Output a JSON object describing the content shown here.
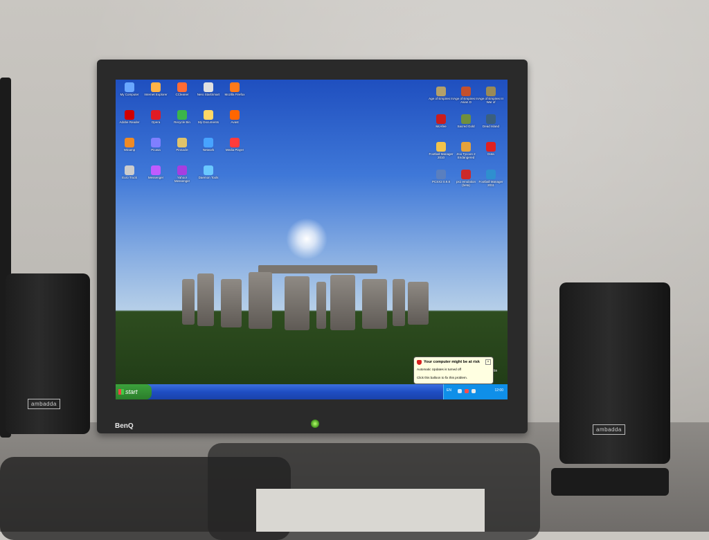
{
  "monitor": {
    "brand": "BenQ"
  },
  "speakers": {
    "brand": "ambadda"
  },
  "desktop": {
    "icons_left": [
      {
        "label": "My Computer",
        "color": "#6aa7ff"
      },
      {
        "label": "Internet Explorer",
        "color": "#ffb347"
      },
      {
        "label": "CCleaner",
        "color": "#ff6b35"
      },
      {
        "label": "Nero StartSmart",
        "color": "#e0e0e0"
      },
      {
        "label": "Mozilla Firefox",
        "color": "#ff7a1a"
      },
      {
        "label": "Adobe Reader",
        "color": "#d00000"
      },
      {
        "label": "Opera",
        "color": "#e01b24"
      },
      {
        "label": "Recycle Bin",
        "color": "#3bb54a"
      },
      {
        "label": "My Documents",
        "color": "#ffd866"
      },
      {
        "label": "Avast",
        "color": "#ff6600"
      },
      {
        "label": "Winamp",
        "color": "#f08a24"
      },
      {
        "label": "Picasa",
        "color": "#7f7fff"
      },
      {
        "label": "Pinnacle",
        "color": "#e0c36a"
      },
      {
        "label": "Network",
        "color": "#47a3ff"
      },
      {
        "label": "Media Player",
        "color": "#ff3b3b"
      },
      {
        "label": "Euro Truck",
        "color": "#cccccc"
      },
      {
        "label": "Messenger",
        "color": "#c05cff"
      },
      {
        "label": "Yahoo! Messenger",
        "color": "#a63ee0"
      },
      {
        "label": "Daemon Tools",
        "color": "#6ac8ff"
      }
    ],
    "icons_right": [
      {
        "label": "Age of Empires III",
        "color": "#b3a06a"
      },
      {
        "label": "Age of Empires III Asian D",
        "color": "#c4502e"
      },
      {
        "label": "Age of Empires III War of",
        "color": "#9a8a56"
      },
      {
        "label": "McAfee",
        "color": "#c91d1d"
      },
      {
        "label": "Sacred Gold",
        "color": "#6f8f3f"
      },
      {
        "label": "Dead Island",
        "color": "#3a5f7f"
      },
      {
        "label": "Football Manager 2010",
        "color": "#f2c34b"
      },
      {
        "label": "Zoo Tycoon 2 Endangered",
        "color": "#e6a23b"
      },
      {
        "label": "Dota",
        "color": "#e02020"
      },
      {
        "label": "PCSX2 0.9.8",
        "color": "#5a7fbf"
      },
      {
        "label": "ps1 emulation (beta)",
        "color": "#cc2a2a"
      },
      {
        "label": "Football Manager 2011",
        "color": "#2f8fcf"
      }
    ],
    "recycle_bin": "Bin"
  },
  "taskbar": {
    "start_label": "start",
    "language": "EN",
    "clock": "12:00"
  },
  "balloon": {
    "title": "Your computer might be at risk",
    "line1": "Automatic Updates is turned off",
    "line2": "Click this balloon to fix this problem."
  },
  "colors": {
    "taskbar_blue": "#1f4ec3",
    "start_green": "#3ca23c",
    "tray_blue": "#0f8fe8",
    "balloon_bg": "#ffffe1"
  }
}
